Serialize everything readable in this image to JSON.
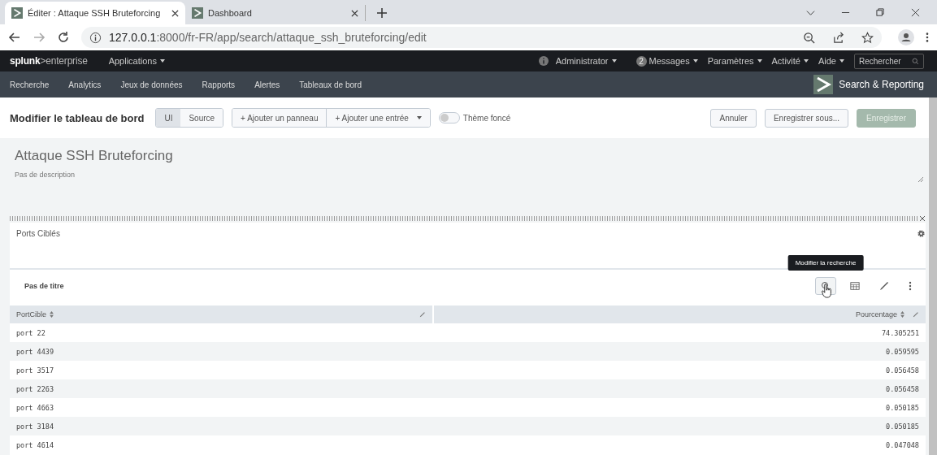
{
  "browser": {
    "tabs": [
      {
        "title": "Éditer : Attaque SSH Bruteforcing",
        "selected": true
      },
      {
        "title": "Dashboard",
        "selected": false
      }
    ],
    "url_host": "127.0.0.1",
    "url_path": ":8000/fr-FR/app/search/attaque_ssh_bruteforcing/edit"
  },
  "splunk_bar": {
    "logo_brand": "splunk",
    "logo_product": ">enterprise",
    "apps_menu": "Applications",
    "menus": [
      {
        "kind": "info",
        "label": "Administrator"
      },
      {
        "kind": "count",
        "badge": "2",
        "label": "Messages"
      },
      {
        "kind": "plain",
        "label": "Paramètres"
      },
      {
        "kind": "plain",
        "label": "Activité"
      },
      {
        "kind": "plain",
        "label": "Aide"
      }
    ],
    "search_placeholder": "Rechercher"
  },
  "app_nav": {
    "items": [
      "Recherche",
      "Analytics",
      "Jeux de données",
      "Rapports",
      "Alertes",
      "Tableaux de bord"
    ],
    "app_name": "Search & Reporting"
  },
  "edit_toolbar": {
    "title": "Modifier le tableau de bord",
    "modes": [
      {
        "label": "UI",
        "selected": true
      },
      {
        "label": "Source",
        "selected": false
      }
    ],
    "add_buttons": [
      {
        "label": "+ Ajouter un panneau",
        "dropdown": false
      },
      {
        "label": "+ Ajouter une entrée",
        "dropdown": true
      }
    ],
    "dark_theme": {
      "label": "Thème foncé",
      "on": false
    },
    "actions": [
      {
        "label": "Annuler",
        "kind": "secondary"
      },
      {
        "label": "Enregistrer sous...",
        "kind": "secondary"
      },
      {
        "label": "Enregistrer",
        "kind": "primary",
        "disabled": true
      }
    ]
  },
  "dashboard": {
    "title": "Attaque SSH Bruteforcing",
    "description": "Pas de description"
  },
  "panel": {
    "title": "Ports Ciblés",
    "element_title": "Pas de titre",
    "tooltip": "Modifier la recherche",
    "table": {
      "columns": [
        {
          "label": "PortCible"
        },
        {
          "label": "Pourcentage"
        }
      ],
      "rows": [
        [
          "port 22",
          "74.305251"
        ],
        [
          "port 4439",
          "0.059595"
        ],
        [
          "port 3517",
          "0.056458"
        ],
        [
          "port 2263",
          "0.056458"
        ],
        [
          "port 4663",
          "0.050185"
        ],
        [
          "port 3184",
          "0.050185"
        ],
        [
          "port 4614",
          "0.047048"
        ]
      ]
    }
  }
}
